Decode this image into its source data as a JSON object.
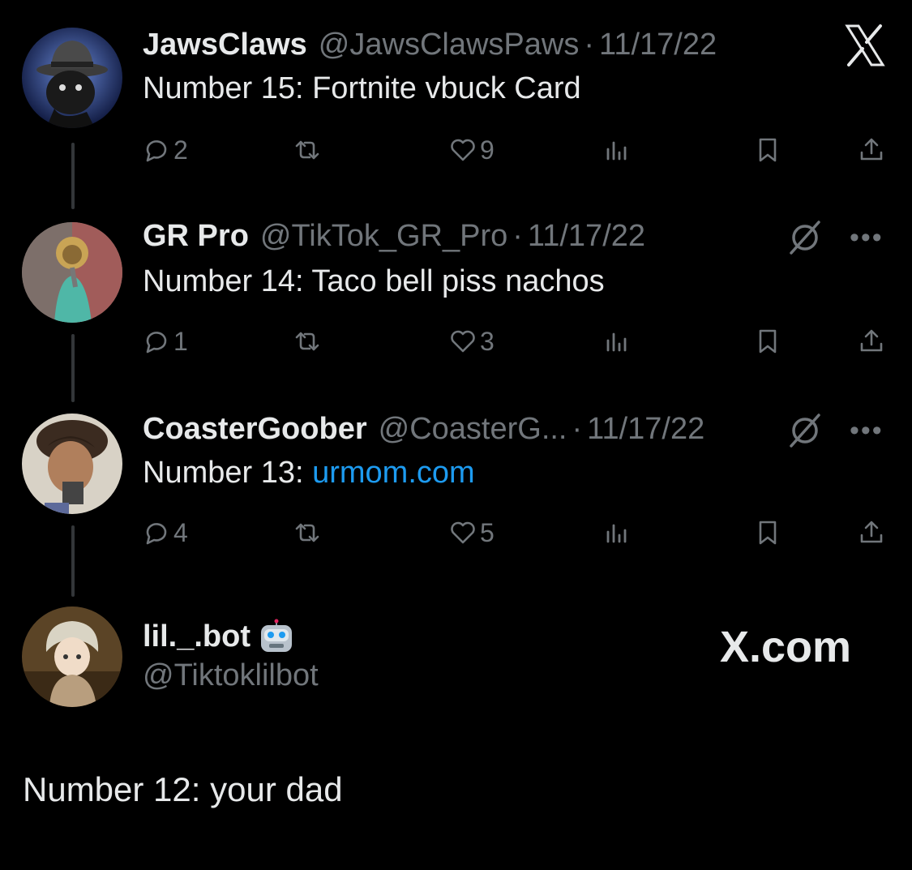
{
  "colors": {
    "background": "#000000",
    "text": "#e7e9ea",
    "muted": "#71767b",
    "link": "#1d9bf0",
    "thread_line": "#333639"
  },
  "brand": {
    "x_logo": "X",
    "watermark": "X.com"
  },
  "posts": [
    {
      "name": "JawsClaws",
      "handle": "@JawsClawsPaws",
      "separator": "·",
      "date": "11/17/22",
      "text": "Number 15: Fortnite vbuck Card",
      "replies": "2",
      "likes": "9"
    },
    {
      "name": "GR Pro",
      "handle": "@TikTok_GR_Pro",
      "separator": "·",
      "date": "11/17/22",
      "text": "Number 14: Taco bell piss nachos",
      "replies": "1",
      "likes": "3",
      "more": "•••"
    },
    {
      "name": "CoasterGoober",
      "handle": "@CoasterG...",
      "separator": "·",
      "date": "11/17/22",
      "text_prefix": "Number 13: ",
      "link": "urmom.com",
      "replies": "4",
      "likes": "5",
      "more": "•••"
    }
  ],
  "main_post": {
    "name": "lil._.bot",
    "emoji": "robot-face-icon",
    "handle": "@Tiktoklilbot",
    "text": "Number 12: your dad"
  },
  "icons": [
    "reply-icon",
    "repost-icon",
    "like-icon",
    "views-icon",
    "bookmark-icon",
    "share-icon",
    "mute-icon",
    "more-icon",
    "x-logo-icon"
  ]
}
